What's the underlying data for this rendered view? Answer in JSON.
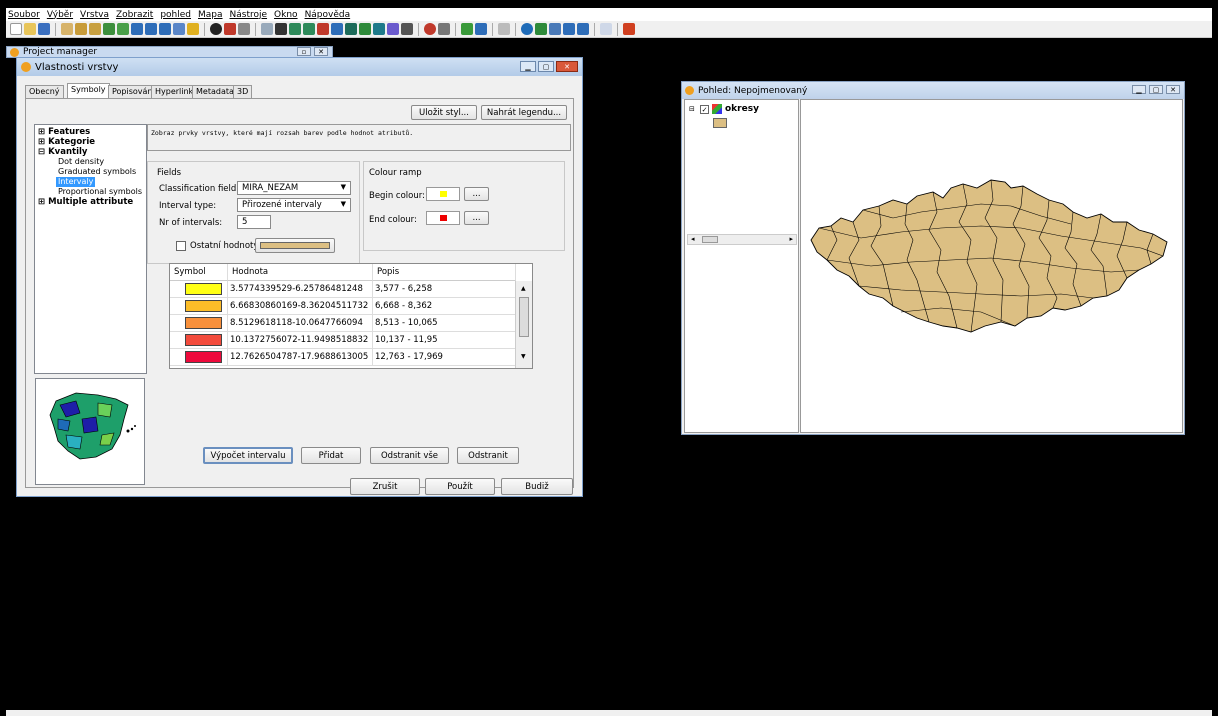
{
  "menubar": {
    "items": [
      "Soubor",
      "Výběr",
      "Vrstva",
      "Zobrazit",
      "pohled",
      "Mapa",
      "Nástroje",
      "Okno",
      "Nápověda"
    ]
  },
  "project_manager": {
    "title": "Project manager"
  },
  "layer_props": {
    "title": "Vlastnosti vrstvy",
    "tabs": [
      "Obecný",
      "Symboly",
      "Popisování",
      "Hyperlink",
      "Metadata",
      "3D"
    ],
    "save_style": "Uložit styl...",
    "load_legend": "Nahrát legendu...",
    "tree": {
      "features": "Features",
      "kategorie": "Kategorie",
      "kvantily": "Kvantily",
      "children": [
        "Dot density",
        "Graduated symbols",
        "Intervaly",
        "Proportional symbols"
      ],
      "multiple": "Multiple attribute"
    },
    "description": "Zobraz prvky vrstvy, které mají rozsah barev podle hodnot atributů.",
    "fields": {
      "group": "Fields",
      "classification_label": "Classification field:",
      "classification_value": "MIRA_NEZAM",
      "interval_type_label": "Interval type:",
      "interval_type_value": "Přirozené intervaly",
      "nr_label": "Nr of intervals:",
      "nr_value": "5",
      "other_values_label": "Ostatní hodnoty:"
    },
    "ramp": {
      "group": "Colour ramp",
      "begin_label": "Begin colour:",
      "end_label": "End colour:",
      "begin_color": "#ffff00",
      "end_color": "#ee0000",
      "dots": "..."
    },
    "table": {
      "headers": [
        "Symbol",
        "Hodnota",
        "Popis"
      ],
      "rows": [
        {
          "color": "#ffff14",
          "value": "3.5774339529-6.25786481248",
          "label": "3,577 - 6,258"
        },
        {
          "color": "#fcbd28",
          "value": "6.66830860169-8.36204511732",
          "label": "6,668 - 8,362"
        },
        {
          "color": "#f8903b",
          "value": "8.5129618118-10.0647766094",
          "label": "8,513 - 10,065"
        },
        {
          "color": "#f34b3c",
          "value": "10.1372756072-11.9498518832",
          "label": "10,137 - 11,95"
        },
        {
          "color": "#ee0a3c",
          "value": "12.7626504787-17.9688613005",
          "label": "12,763 - 17,969"
        }
      ]
    },
    "buttons": {
      "calc": "Výpočet intervalu",
      "add": "Přidat",
      "remove_all": "Odstranit vše",
      "remove": "Odstranit",
      "cancel": "Zrušit",
      "apply": "Použít",
      "ok": "Budiž"
    }
  },
  "view": {
    "title": "Pohled: Nepojmenovaný",
    "layer": "okresy",
    "fill_color": "#dcbf83"
  }
}
